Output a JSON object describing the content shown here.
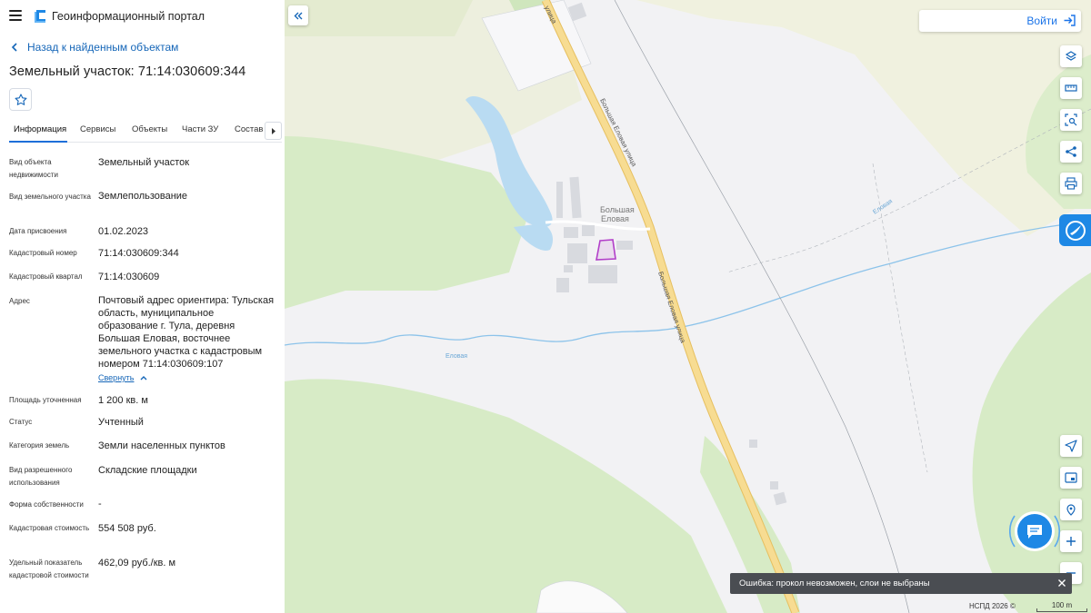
{
  "app": {
    "title": "Геоинформационный портал"
  },
  "panel": {
    "back_label": "Назад к найденным объектам",
    "object_title": "Земельный участок: 71:14:030609:344",
    "tabs": [
      {
        "label": "Информация",
        "active": true
      },
      {
        "label": "Сервисы"
      },
      {
        "label": "Объекты"
      },
      {
        "label": "Части ЗУ"
      },
      {
        "label": "Состав"
      }
    ],
    "properties": [
      {
        "label": "Вид объекта недвижимости",
        "value": "Земельный участок"
      },
      {
        "label": "Вид земельного участка",
        "value": "Землепользование"
      },
      {
        "label": "Дата присвоения",
        "value": "01.02.2023"
      },
      {
        "label": "Кадастровый номер",
        "value": "71:14:030609:344"
      },
      {
        "label": "Кадастровый квартал",
        "value": "71:14:030609"
      },
      {
        "label": "Адрес",
        "value": "Почтовый адрес ориентира: Тульская область, муниципальное образование г. Тула, деревня Большая Еловая, восточнее земельного участка с кадастровым номером 71:14:030609:107"
      },
      {
        "label": "Площадь уточненная",
        "value": "1 200 кв. м"
      },
      {
        "label": "Статус",
        "value": "Учтенный"
      },
      {
        "label": "Категория земель",
        "value": "Земли населенных пунктов"
      },
      {
        "label": "Вид разрешенного использования",
        "value": "Складские площадки"
      },
      {
        "label": "Форма собственности",
        "value": "-"
      },
      {
        "label": "Кадастровая стоимость",
        "value": "554 508 руб."
      },
      {
        "label": "Удельный показатель кадастровой стоимости",
        "value": "462,09 руб./кв. м"
      }
    ],
    "collapse_label": "Свернуть"
  },
  "map": {
    "login_label": "Войти",
    "labels": {
      "street_1": "Большая Еловая улица",
      "street_2": "Большая Еловая улица",
      "village_line1": "Большая",
      "village_line2": "Еловая",
      "stream": "Еловая",
      "stream_2": "Еловая"
    },
    "toast": "Ошибка: прокол невозможен, слои не выбраны",
    "attribution": "НСПД 2026 ©",
    "scale": "100 m",
    "colors": {
      "forest": "#d3e9c3",
      "field": "#eef0dc",
      "water": "#b5d9f3",
      "road": "#f5d78a",
      "parcel": "#b23fc9",
      "accent": "#1e88e5"
    }
  }
}
